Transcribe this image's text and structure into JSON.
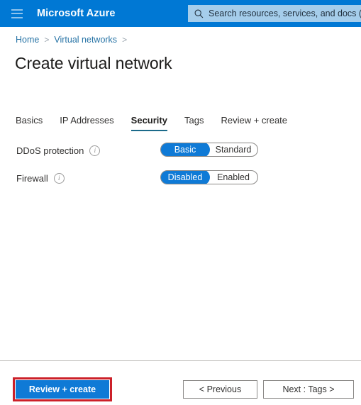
{
  "header": {
    "menu_icon": "hamburger-icon",
    "brand": "Microsoft Azure",
    "search": {
      "icon": "search-icon",
      "placeholder": "Search resources, services, and docs (G",
      "value": ""
    }
  },
  "breadcrumb": {
    "items": [
      {
        "label": "Home"
      },
      {
        "label": "Virtual networks"
      }
    ],
    "separator": ">"
  },
  "page": {
    "title": "Create virtual network"
  },
  "tabs": [
    {
      "label": "Basics",
      "active": false
    },
    {
      "label": "IP Addresses",
      "active": false
    },
    {
      "label": "Security",
      "active": true
    },
    {
      "label": "Tags",
      "active": false
    },
    {
      "label": "Review + create",
      "active": false
    }
  ],
  "form": {
    "ddos": {
      "label": "DDoS protection",
      "info_icon": "info-icon",
      "options": [
        "Basic",
        "Standard"
      ],
      "selected": "Basic"
    },
    "firewall": {
      "label": "Firewall",
      "info_icon": "info-icon",
      "options": [
        "Disabled",
        "Enabled"
      ],
      "selected": "Disabled"
    }
  },
  "footer": {
    "review_create_label": "Review + create",
    "previous_label": "< Previous",
    "next_label": "Next : Tags >"
  },
  "colors": {
    "azure_blue": "#0078d4",
    "accent_blue": "#0f7ad6",
    "tab_underline": "#1b6a8a",
    "annotation_red": "#cc2029",
    "search_bg": "#a5cdeb"
  }
}
